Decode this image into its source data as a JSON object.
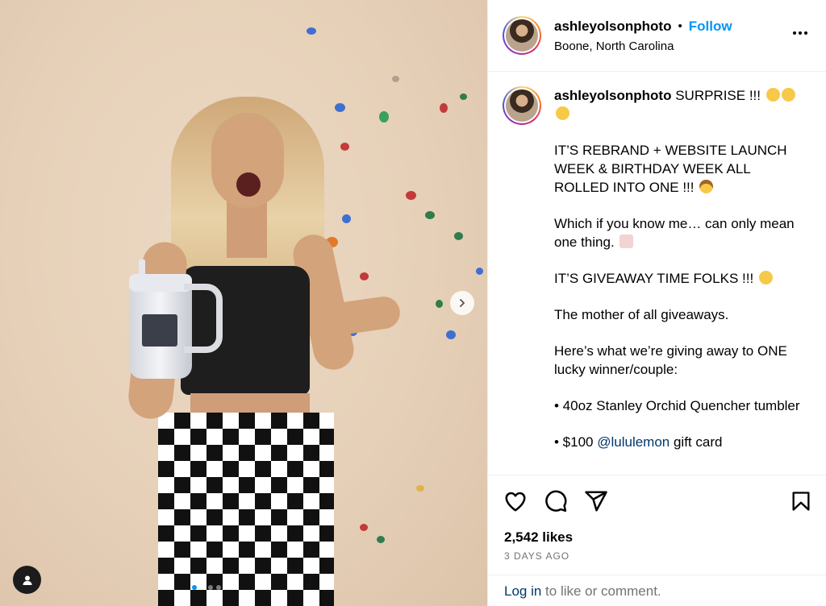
{
  "header": {
    "username": "ashleyolsonphoto",
    "separator": "•",
    "follow_label": "Follow",
    "location": "Boone, North Carolina",
    "more_icon": "more-horizontal-icon"
  },
  "caption": {
    "username": "ashleyolsonphoto",
    "first_line": "SURPRISE !!!",
    "paragraphs": [
      "IT’S REBRAND + WEBSITE LAUNCH WEEK & BIRTHDAY WEEK ALL ROLLED INTO ONE !!!",
      "Which if you know me… can only mean one thing.",
      "IT’S GIVEAWAY TIME FOLKS !!!",
      "The mother of all giveaways.",
      "Here’s what we’re giving away to ONE lucky winner/couple:",
      "• 40oz Stanley Orchid Quencher tumbler"
    ],
    "last_line_prefix": "• $100 ",
    "mention": "@lululemon",
    "last_line_suffix": " gift card"
  },
  "actions": {
    "like_icon": "heart-icon",
    "comment_icon": "comment-icon",
    "share_icon": "share-icon",
    "save_icon": "bookmark-icon"
  },
  "likes": "2,542 likes",
  "date": "3 DAYS AGO",
  "login": {
    "link": "Log in",
    "text": " to like or comment."
  },
  "colors": {
    "link_blue": "#0095f6",
    "mention_blue": "#00376b",
    "muted": "#737373"
  }
}
